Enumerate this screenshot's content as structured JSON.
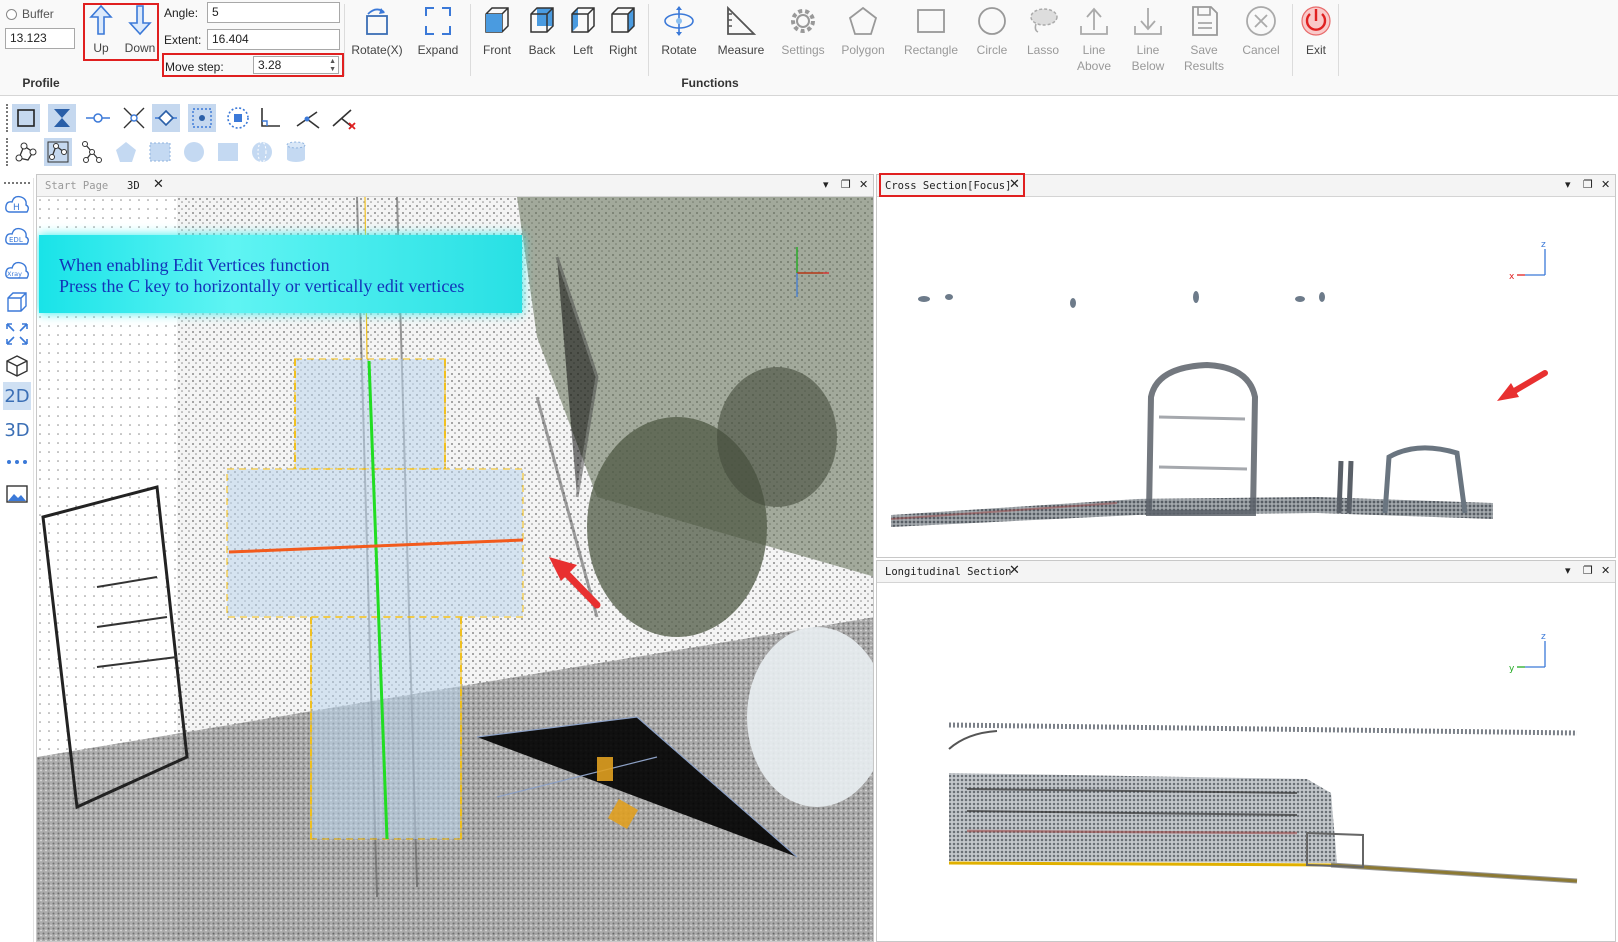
{
  "profile": {
    "buffer_label": "Buffer",
    "buffer_value": "13.123",
    "up_label": "Up",
    "down_label": "Down",
    "angle_label": "Angle:",
    "angle_value": "5",
    "extent_label": "Extent:",
    "extent_value": "16.404",
    "move_step_label": "Move step:",
    "move_step_value": "3.28",
    "group_title": "Profile"
  },
  "functions": {
    "group_title": "Functions",
    "buttons": [
      {
        "label": "Rotate(X)",
        "icon": "rotate-x-icon"
      },
      {
        "label": "Expand",
        "icon": "expand-icon"
      },
      {
        "label": "Front",
        "icon": "cube-front-icon"
      },
      {
        "label": "Back",
        "icon": "cube-back-icon"
      },
      {
        "label": "Left",
        "icon": "cube-left-icon"
      },
      {
        "label": "Right",
        "icon": "cube-right-icon"
      },
      {
        "label": "Rotate",
        "icon": "rotate-icon"
      },
      {
        "label": "Measure",
        "icon": "measure-icon"
      },
      {
        "label": "Settings",
        "icon": "gear-icon"
      },
      {
        "label": "Polygon",
        "icon": "polygon-icon"
      },
      {
        "label": "Rectangle",
        "icon": "rectangle-icon"
      },
      {
        "label": "Circle",
        "icon": "circle-icon"
      },
      {
        "label": "Lasso",
        "icon": "lasso-icon"
      },
      {
        "label": "Line Above",
        "line1": "Line",
        "line2": "Above",
        "icon": "line-above-icon"
      },
      {
        "label": "Line Below",
        "line1": "Line",
        "line2": "Below",
        "icon": "line-below-icon"
      },
      {
        "label": "Save Results",
        "line1": "Save",
        "line2": "Results",
        "icon": "save-results-icon"
      },
      {
        "label": "Cancel",
        "icon": "cancel-icon"
      },
      {
        "label": "Exit",
        "icon": "power-icon"
      }
    ]
  },
  "panels": {
    "view3d": {
      "tabs": [
        "Start Page",
        "3D"
      ],
      "banner_line1": "When enabling Edit Vertices function",
      "banner_line2": "Press the C key to horizontally or vertically edit vertices"
    },
    "cross_section": {
      "title": "Cross Section[Focus]",
      "axis_x": "x",
      "axis_z": "z"
    },
    "longitudinal_section": {
      "title": "Longitudinal Section",
      "axis_y": "y",
      "axis_z": "z"
    }
  },
  "leftbar": {
    "labels": [
      "2D",
      "3D"
    ]
  },
  "colors": {
    "accent_blue": "#3b79d8",
    "highlight_red": "#e02020",
    "banner_cyan": "#19e3e8",
    "green_line": "#22dd22",
    "orange_line": "#f25a1c"
  }
}
